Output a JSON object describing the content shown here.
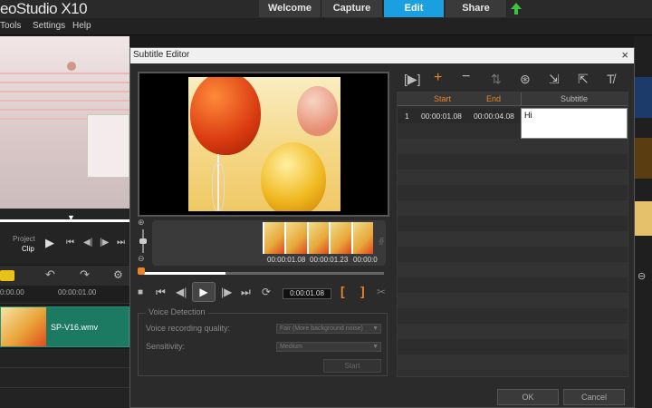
{
  "app": {
    "title": "eoStudio X10"
  },
  "tabs": [
    {
      "label": "Welcome"
    },
    {
      "label": "Capture"
    },
    {
      "label": "Edit"
    },
    {
      "label": "Share"
    }
  ],
  "menu": {
    "items": [
      "Tools",
      "Settings",
      "Help"
    ]
  },
  "preview": {
    "project_label": "Project",
    "clip_label": "Clip"
  },
  "timeline": {
    "time0": "0:00.00",
    "time1": "00:00:01.00",
    "clip_name": "SP-V16.wmv"
  },
  "dialog": {
    "title": "Subtitle Editor",
    "close": "×",
    "filmstrip_timecodes": [
      "00:00:01.08",
      "00:00:01.23",
      "00:00:0"
    ],
    "timecode": "0:00:01.08",
    "voice": {
      "legend": "Voice Detection",
      "quality_label": "Voice recording quality:",
      "quality_value": "Fair (More background noise)",
      "sensitivity_label": "Sensitivity:",
      "sensitivity_value": "Medium",
      "start_label": "Start"
    },
    "table": {
      "headers": {
        "start": "Start",
        "end": "End",
        "subtitle": "Subtitle"
      },
      "rows": [
        {
          "index": "1",
          "start": "00:00:01.08",
          "end": "00:00:04.08",
          "subtitle": "Hi"
        }
      ]
    },
    "ok_label": "OK",
    "cancel_label": "Cancel"
  },
  "colors": {
    "accent": "#1aa0e0",
    "orange": "#e8852a",
    "clip": "#1c7a63"
  }
}
